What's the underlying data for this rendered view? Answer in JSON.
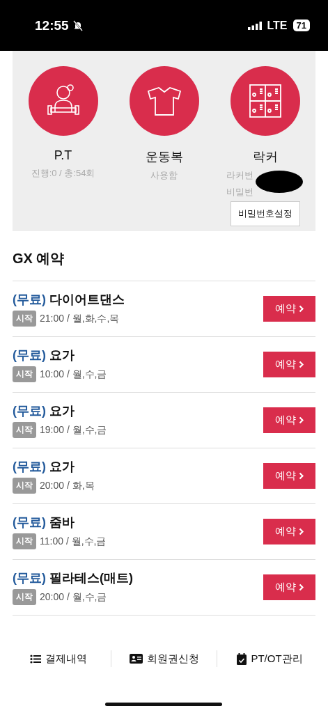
{
  "status_bar": {
    "time": "12:55",
    "network": "LTE",
    "battery": "71"
  },
  "services": [
    {
      "kind": "trainer",
      "title": "P.T",
      "lines": [
        "진행:0 / 총:54회"
      ]
    },
    {
      "kind": "shirt",
      "title": "운동복",
      "lines": [
        "사용함"
      ]
    },
    {
      "kind": "locker",
      "title": "락커",
      "lines": [
        "라커번",
        "비밀번"
      ],
      "redacted": true,
      "button": "비밀번호설정"
    }
  ],
  "gx": {
    "title": "GX 예약",
    "classes": [
      {
        "tag": "(무료)",
        "name": "다이어트댄스",
        "badge": "시작",
        "schedule": "21:00 / 월,화,수,목",
        "button": "예약"
      },
      {
        "tag": "(무료)",
        "name": "요가",
        "badge": "시작",
        "schedule": "10:00 / 월,수,금",
        "button": "예약"
      },
      {
        "tag": "(무료)",
        "name": "요가",
        "badge": "시작",
        "schedule": "19:00 / 월,수,금",
        "button": "예약"
      },
      {
        "tag": "(무료)",
        "name": "요가",
        "badge": "시작",
        "schedule": "20:00 / 화,목",
        "button": "예약"
      },
      {
        "tag": "(무료)",
        "name": "줌바",
        "badge": "시작",
        "schedule": "11:00 / 월,수,금",
        "button": "예약"
      },
      {
        "tag": "(무료)",
        "name": "필라테스(매트)",
        "badge": "시작",
        "schedule": "20:00 / 월,수,금",
        "button": "예약"
      }
    ]
  },
  "bottom_nav": [
    {
      "kind": "list",
      "label": "결제내역"
    },
    {
      "kind": "card",
      "label": "회원권신청"
    },
    {
      "kind": "calendar",
      "label": "PT/OT관리"
    }
  ]
}
